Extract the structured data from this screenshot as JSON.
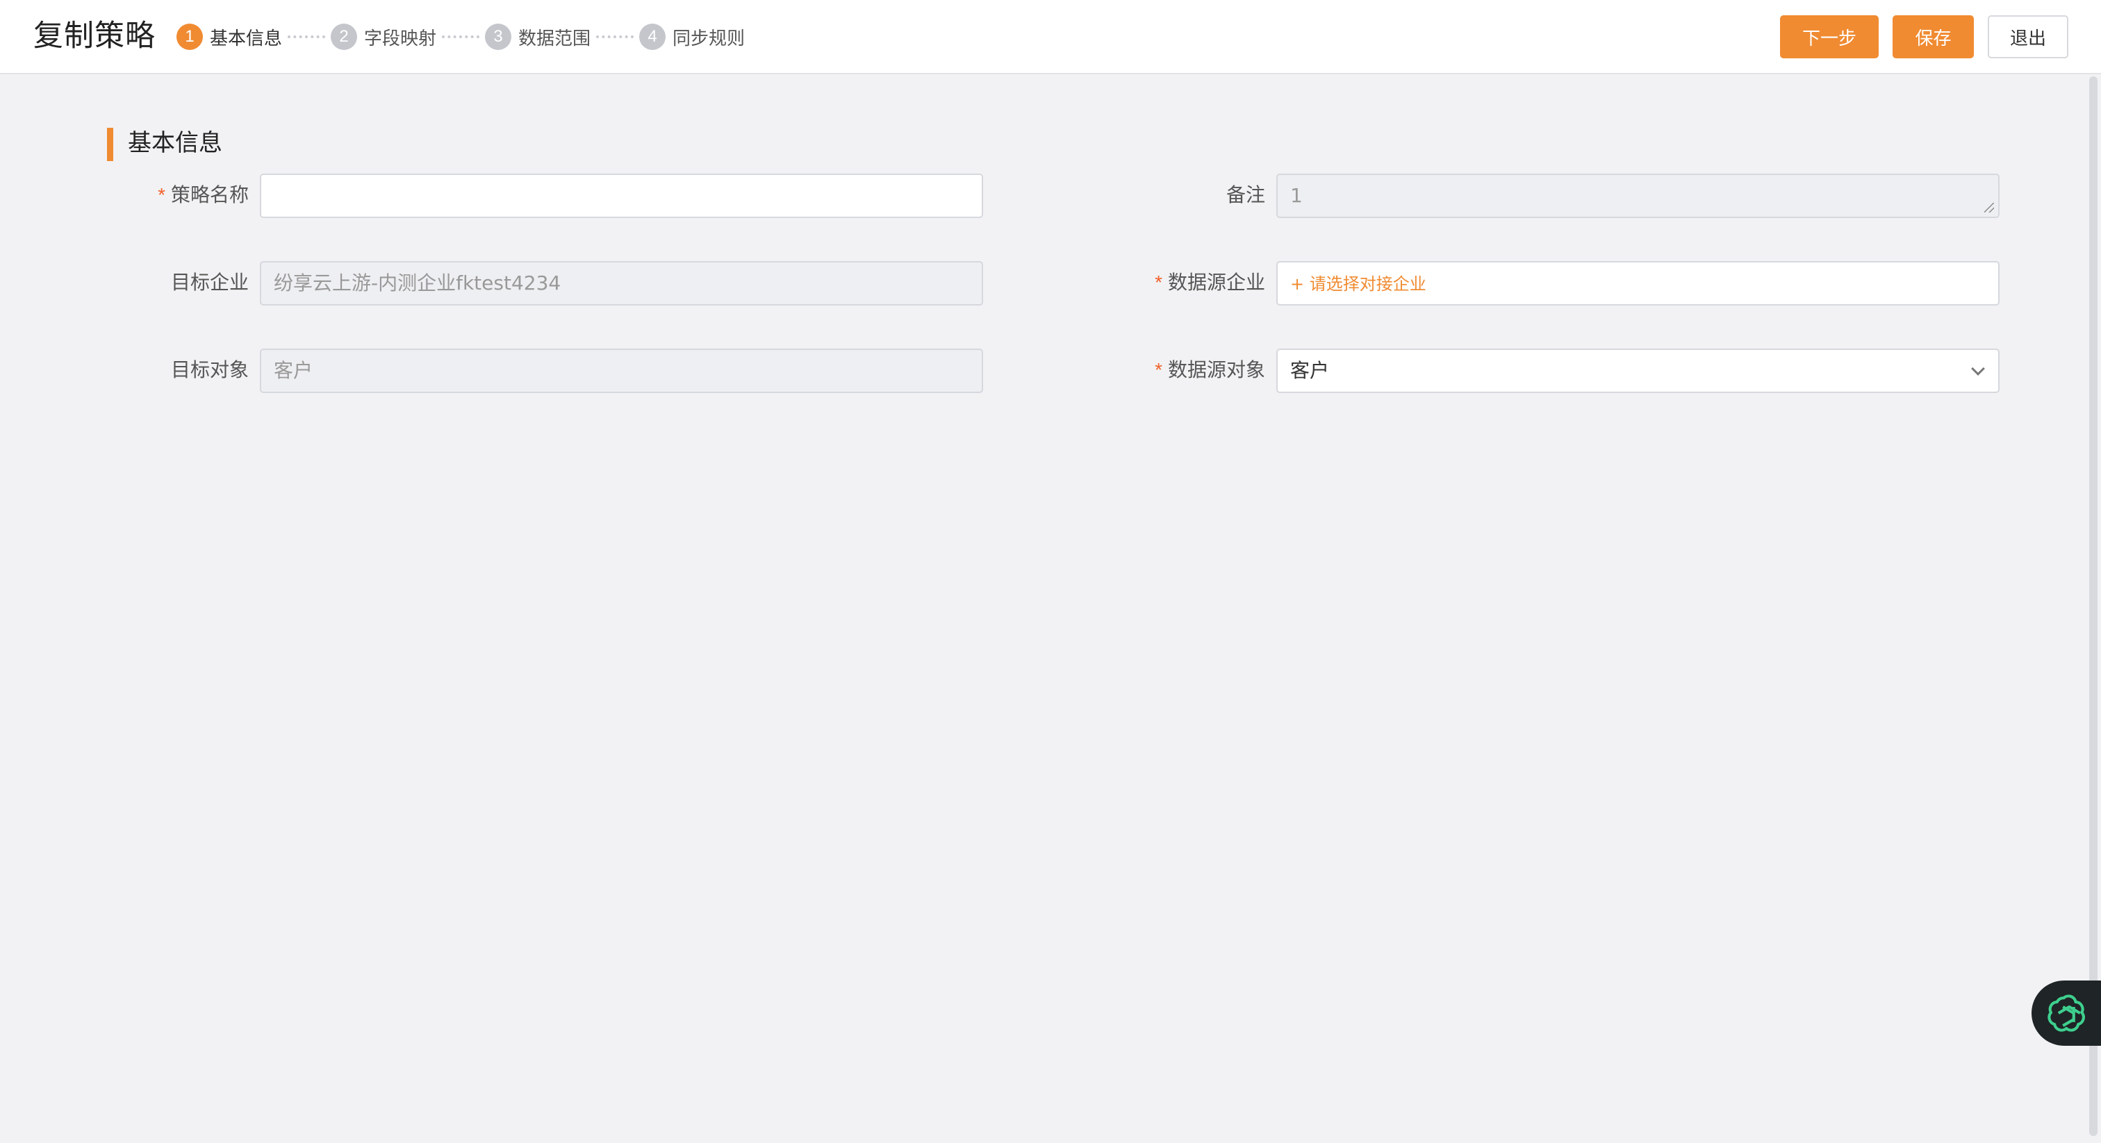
{
  "header": {
    "title": "复制策略",
    "steps": [
      {
        "num": "1",
        "label": "基本信息",
        "active": true
      },
      {
        "num": "2",
        "label": "字段映射",
        "active": false
      },
      {
        "num": "3",
        "label": "数据范围",
        "active": false
      },
      {
        "num": "4",
        "label": "同步规则",
        "active": false
      }
    ],
    "buttons": {
      "next": "下一步",
      "save": "保存",
      "exit": "退出"
    }
  },
  "section": {
    "title": "基本信息"
  },
  "form": {
    "required_mark": "*",
    "strategy_name": {
      "label": "策略名称",
      "value": "",
      "required": true
    },
    "remark": {
      "label": "备注",
      "value": "1"
    },
    "target_company": {
      "label": "目标企业",
      "value": "纷享云上游-内测企业fktest4234"
    },
    "source_company": {
      "label": "数据源企业",
      "link": "+ 请选择对接企业",
      "required": true
    },
    "target_object": {
      "label": "目标对象",
      "value": "客户"
    },
    "source_object": {
      "label": "数据源对象",
      "value": "客户",
      "required": true
    }
  },
  "colors": {
    "accent": "#f08b32",
    "required": "#f0602b",
    "assistant_bg": "#1f2426",
    "assistant_icon": "#3ecf8e"
  },
  "icons": {
    "select": "chevron-down-icon",
    "assistant": "ai-assistant-icon"
  }
}
